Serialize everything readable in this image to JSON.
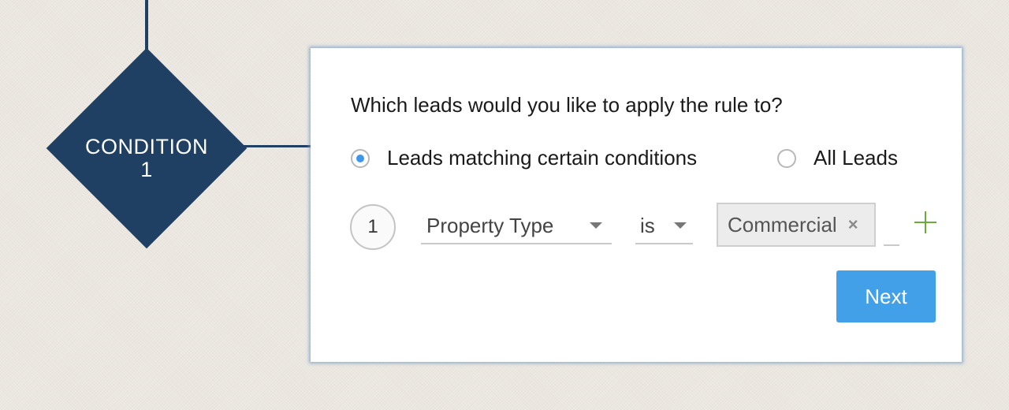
{
  "flow": {
    "node": {
      "label_line1": "CONDITION",
      "label_line2": "1"
    }
  },
  "panel": {
    "question": "Which leads would you like to apply the rule to?",
    "options": [
      {
        "label": "Leads matching certain conditions",
        "selected": true
      },
      {
        "label": "All Leads",
        "selected": false
      }
    ],
    "criteria": [
      {
        "index": "1",
        "field": "Property Type",
        "operator": "is",
        "values": [
          "Commercial"
        ],
        "remove_icon": "×"
      }
    ],
    "next_label": "Next"
  },
  "colors": {
    "node": "#1f4063",
    "accent": "#41a0e8",
    "radio_selected": "#3d98ec",
    "add": "#6aab3a"
  }
}
